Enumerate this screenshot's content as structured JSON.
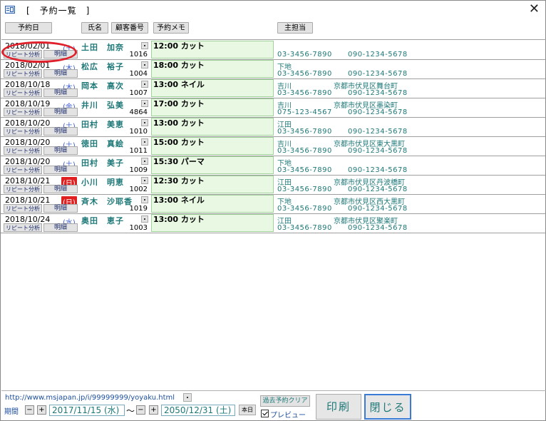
{
  "window": {
    "title": "[　予約一覧　]",
    "close": "✕"
  },
  "headers": {
    "date": "予約日",
    "name": "氏名",
    "customer_no": "顧客番号",
    "memo": "予約メモ",
    "staff": "主担当"
  },
  "buttons": {
    "repeat": "リピート分析",
    "detail": "明細"
  },
  "rows": [
    {
      "date": "2018/02/01",
      "weekday": "(土)",
      "name": "土田　加奈",
      "id": "1016",
      "memo": "12:00 カット",
      "staff": "",
      "address": "",
      "tel": "03-3456-7890",
      "mobile": "090-1234-5678"
    },
    {
      "date": "2018/02/01",
      "weekday": "(木)",
      "name": "松広　裕子",
      "id": "1004",
      "memo": "18:00 カット",
      "staff": "下地",
      "address": "",
      "tel": "03-3456-7890",
      "mobile": "090-1234-5678"
    },
    {
      "date": "2018/10/18",
      "weekday": "(木)",
      "name": "岡本　高次",
      "id": "1007",
      "memo": "13:00 ネイル",
      "staff": "吉川",
      "address": "京都市伏見区舞台町",
      "tel": "03-3456-7890",
      "mobile": "090-1234-5678"
    },
    {
      "date": "2018/10/19",
      "weekday": "(金)",
      "name": "井川　弘美",
      "id": "4864",
      "memo": "17:00 カット",
      "staff": "吉川",
      "address": "京都市伏見区墨染町",
      "tel": "075-123-4567",
      "mobile": "090-1234-5678"
    },
    {
      "date": "2018/10/20",
      "weekday": "(土)",
      "name": "田村　美恵",
      "id": "1010",
      "memo": "13:00 カット",
      "staff": "江田",
      "address": "",
      "tel": "03-3456-7890",
      "mobile": "090-1234-5678"
    },
    {
      "date": "2018/10/20",
      "weekday": "(土)",
      "name": "徳田　真絵",
      "id": "1011",
      "memo": "15:00 カット",
      "staff": "吉川",
      "address": "京都市伏見区東大黒町",
      "tel": "03-3456-7890",
      "mobile": "090-1234-5678"
    },
    {
      "date": "2018/10/20",
      "weekday": "(土)",
      "name": "田村　美子",
      "id": "1009",
      "memo": "15:30 パーマ",
      "staff": "下地",
      "address": "",
      "tel": "03-3456-7890",
      "mobile": "090-1234-5678"
    },
    {
      "date": "2018/10/21",
      "weekday": "(日)",
      "holiday": true,
      "name": "小川　明恵",
      "id": "1002",
      "memo": "12:30 カット",
      "staff": "江田",
      "address": "京都市伏見区丹波橋町",
      "tel": "03-3456-7890",
      "mobile": "090-1234-5678"
    },
    {
      "date": "2018/10/21",
      "weekday": "(日)",
      "holiday": true,
      "name": "斉木　沙耶香",
      "id": "1019",
      "memo": "13:00 ネイル",
      "staff": "下地",
      "address": "京都市伏見区西大黒町",
      "tel": "03-3456-7890",
      "mobile": "090-1234-5678"
    },
    {
      "date": "2018/10/24",
      "weekday": "(水)",
      "name": "奥田　恵子",
      "id": "1003",
      "memo": "13:00 カット",
      "staff": "江田",
      "address": "京都市伏見区聚楽町",
      "tel": "03-3456-7890",
      "mobile": "090-1234-5678"
    }
  ],
  "footer": {
    "url": "http://www.msjapan.jp/i/99999999/yoyaku.html",
    "period_label": "期間",
    "minus": "−",
    "plus": "+",
    "from_date": "2017/11/15 (水)",
    "tilde": "〜",
    "to_date": "2050/12/31 (土)",
    "today": "本日",
    "clear_past": "過去予約クリア",
    "preview_label": "プレビュー",
    "preview_checked": true,
    "print": "印刷",
    "close": "閉じる"
  }
}
